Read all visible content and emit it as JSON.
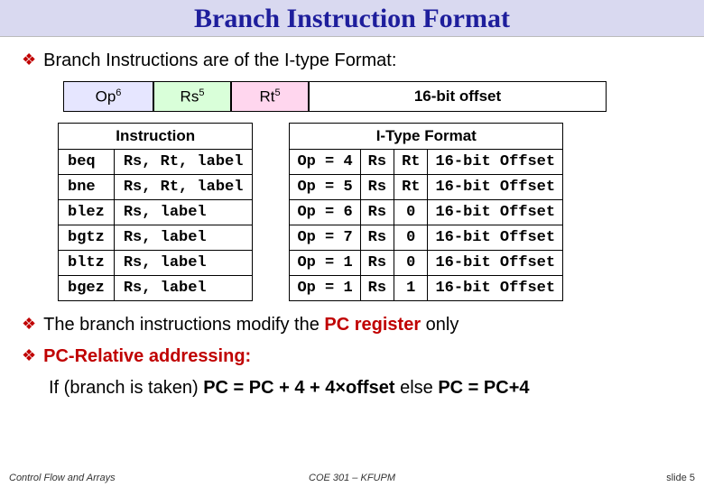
{
  "title": "Branch Instruction Format",
  "bullets": {
    "b1": "Branch Instructions are of the I-type Format:",
    "b2_prefix": "The branch instructions modify the ",
    "b2_bold": "PC register",
    "b2_suffix": " only",
    "b3": "PC-Relative addressing:",
    "b4_prefix": "If (branch is taken) ",
    "b4_bold1": "PC = PC + 4 + 4×offset",
    "b4_mid": " else ",
    "b4_bold2": "PC = PC+4"
  },
  "format_fields": {
    "op": "Op",
    "op_bits": "6",
    "rs": "Rs",
    "rs_bits": "5",
    "rt": "Rt",
    "rt_bits": "5",
    "offset": "16-bit offset"
  },
  "left_header": "Instruction",
  "left_rows": [
    {
      "mn": "beq",
      "ops": "Rs, Rt, label"
    },
    {
      "mn": "bne",
      "ops": "Rs, Rt, label"
    },
    {
      "mn": "blez",
      "ops": "Rs, label"
    },
    {
      "mn": "bgtz",
      "ops": "Rs, label"
    },
    {
      "mn": "bltz",
      "ops": "Rs, label"
    },
    {
      "mn": "bgez",
      "ops": "Rs, label"
    }
  ],
  "right_header": "I-Type Format",
  "right_rows": [
    {
      "op": "Op = 4",
      "rs": "Rs",
      "rt": "Rt",
      "off": "16-bit Offset"
    },
    {
      "op": "Op = 5",
      "rs": "Rs",
      "rt": "Rt",
      "off": "16-bit Offset"
    },
    {
      "op": "Op = 6",
      "rs": "Rs",
      "rt": "0",
      "off": "16-bit Offset"
    },
    {
      "op": "Op = 7",
      "rs": "Rs",
      "rt": "0",
      "off": "16-bit Offset"
    },
    {
      "op": "Op = 1",
      "rs": "Rs",
      "rt": "0",
      "off": "16-bit Offset"
    },
    {
      "op": "Op = 1",
      "rs": "Rs",
      "rt": "1",
      "off": "16-bit Offset"
    }
  ],
  "footer": {
    "left": "Control Flow and Arrays",
    "center": "COE 301 – KFUPM",
    "right": "slide 5"
  }
}
